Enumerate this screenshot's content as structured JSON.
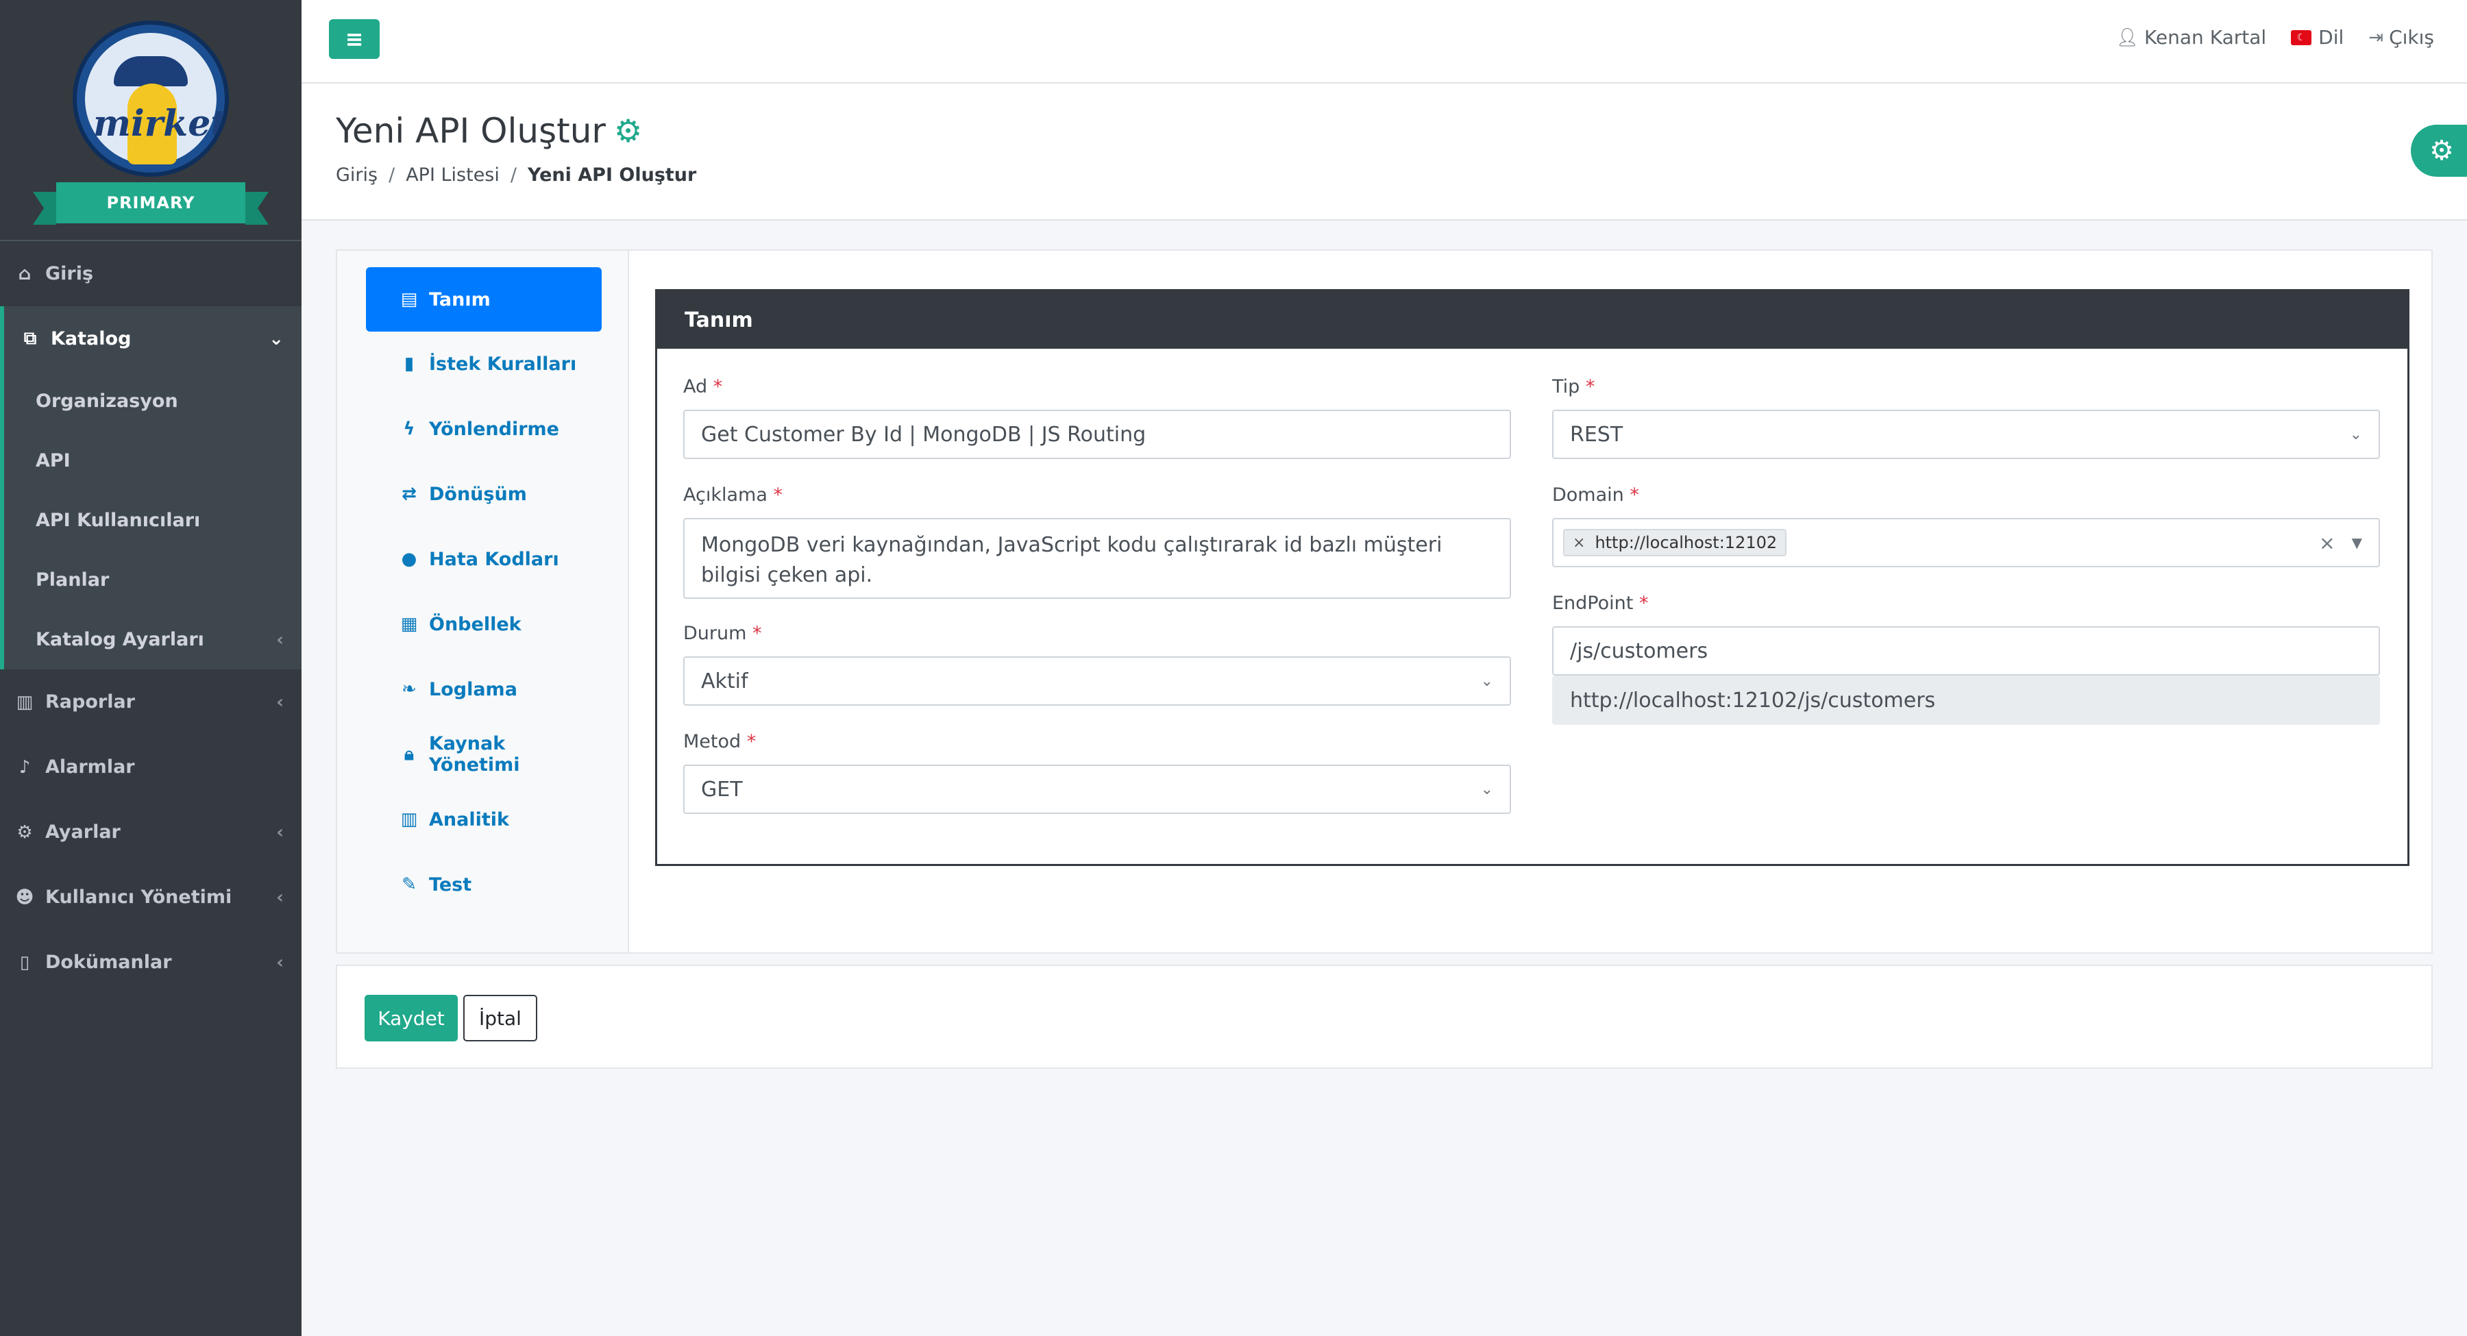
{
  "brand": {
    "logo_text": "mirket",
    "ribbon": "PRIMARY"
  },
  "sidebar": {
    "items": [
      {
        "label": "Giriş",
        "icon": "home-icon"
      },
      {
        "label": "Katalog",
        "icon": "sitemap-icon",
        "expanded": true,
        "children": [
          {
            "label": "Organizasyon"
          },
          {
            "label": "API"
          },
          {
            "label": "API Kullanıcıları"
          },
          {
            "label": "Planlar"
          },
          {
            "label": "Katalog Ayarları"
          }
        ]
      },
      {
        "label": "Raporlar",
        "icon": "chart-icon"
      },
      {
        "label": "Alarmlar",
        "icon": "bell-icon"
      },
      {
        "label": "Ayarlar",
        "icon": "gears-icon"
      },
      {
        "label": "Kullanıcı Yönetimi",
        "icon": "users-icon"
      },
      {
        "label": "Dokümanlar",
        "icon": "file-icon"
      }
    ]
  },
  "topbar": {
    "user": "Kenan Kartal",
    "language": "Dil",
    "logout": "Çıkış"
  },
  "header": {
    "title": "Yeni API Oluştur",
    "breadcrumb": [
      "Giriş",
      "API Listesi",
      "Yeni API Oluştur"
    ]
  },
  "tabs": [
    {
      "label": "Tanım",
      "icon": "id-card-icon",
      "active": true
    },
    {
      "label": "İstek Kuralları",
      "icon": "document-icon"
    },
    {
      "label": "Yönlendirme",
      "icon": "bolt-icon"
    },
    {
      "label": "Dönüşüm",
      "icon": "exchange-icon"
    },
    {
      "label": "Hata Kodları",
      "icon": "exclamation-icon"
    },
    {
      "label": "Önbellek",
      "icon": "memory-icon"
    },
    {
      "label": "Loglama",
      "icon": "leaf-icon"
    },
    {
      "label": "Kaynak Yönetimi",
      "icon": "lock-icon"
    },
    {
      "label": "Analitik",
      "icon": "chart-icon"
    },
    {
      "label": "Test",
      "icon": "pencil-icon"
    }
  ],
  "form": {
    "panel_title": "Tanım",
    "required_mark": "*",
    "ad": {
      "label": "Ad",
      "value": "Get Customer By Id | MongoDB | JS Routing"
    },
    "aciklama": {
      "label": "Açıklama",
      "value": "MongoDB veri kaynağından, JavaScript kodu çalıştırarak id bazlı müşteri bilgisi çeken api."
    },
    "durum": {
      "label": "Durum",
      "value": "Aktif"
    },
    "metod": {
      "label": "Metod",
      "value": "GET"
    },
    "tip": {
      "label": "Tip",
      "value": "REST"
    },
    "domain": {
      "label": "Domain",
      "tag": "http://localhost:12102"
    },
    "endpoint": {
      "label": "EndPoint",
      "value": "/js/customers",
      "full_url": "http://localhost:12102/js/customers"
    }
  },
  "actions": {
    "save": "Kaydet",
    "cancel": "İptal"
  },
  "colors": {
    "accent": "#20a98b",
    "active_tab": "#007bff",
    "sidebar": "#343a40",
    "required": "#dc3545"
  }
}
